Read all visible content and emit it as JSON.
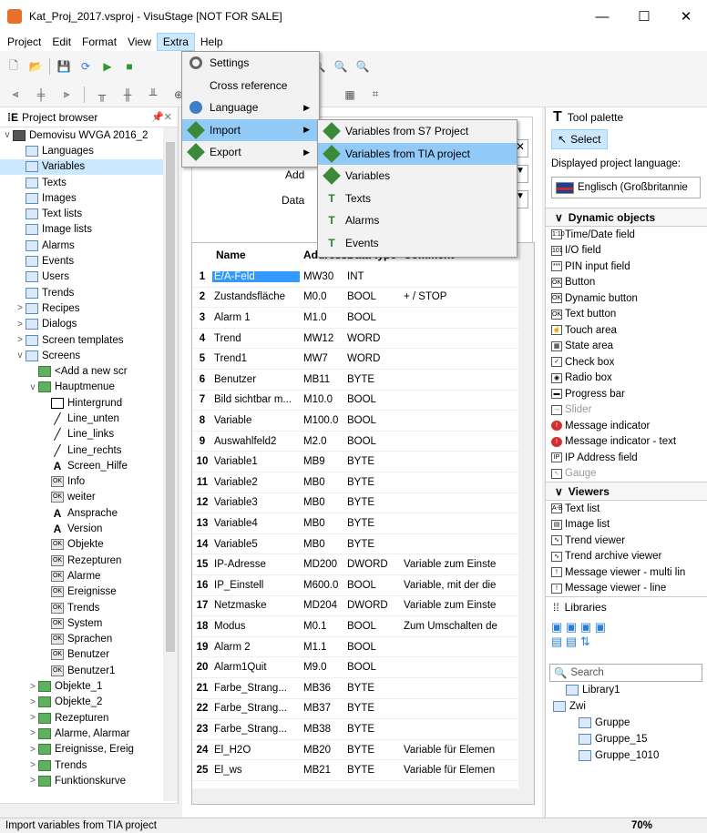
{
  "window": {
    "title": "Kat_Proj_2017.vsproj - VisuStage [NOT FOR SALE]",
    "minimize": "—",
    "maximize": "☐",
    "close": "✕"
  },
  "menubar": [
    "Project",
    "Edit",
    "Format",
    "View",
    "Extra",
    "Help"
  ],
  "project_browser": {
    "title": "Project browser",
    "pin": "📌✕",
    "items": [
      {
        "label": "Demovisu WVGA 2016_2",
        "level": 0,
        "expander": "v",
        "icon": "monitor-icon"
      },
      {
        "label": "Languages",
        "level": 1,
        "expander": "",
        "icon": "folder-icon"
      },
      {
        "label": "Variables",
        "level": 1,
        "expander": "",
        "icon": "folder-icon",
        "selected": true
      },
      {
        "label": "Texts",
        "level": 1,
        "expander": "",
        "icon": "folder-icon"
      },
      {
        "label": "Images",
        "level": 1,
        "expander": "",
        "icon": "folder-icon"
      },
      {
        "label": "Text lists",
        "level": 1,
        "expander": "",
        "icon": "folder-icon"
      },
      {
        "label": "Image lists",
        "level": 1,
        "expander": "",
        "icon": "folder-icon"
      },
      {
        "label": "Alarms",
        "level": 1,
        "expander": "",
        "icon": "folder-icon"
      },
      {
        "label": "Events",
        "level": 1,
        "expander": "",
        "icon": "folder-icon"
      },
      {
        "label": "Users",
        "level": 1,
        "expander": "",
        "icon": "folder-icon"
      },
      {
        "label": "Trends",
        "level": 1,
        "expander": "",
        "icon": "folder-icon"
      },
      {
        "label": "Recipes",
        "level": 1,
        "expander": ">",
        "icon": "folder-icon"
      },
      {
        "label": "Dialogs",
        "level": 1,
        "expander": ">",
        "icon": "folder-icon"
      },
      {
        "label": "Screen templates",
        "level": 1,
        "expander": ">",
        "icon": "folder-icon"
      },
      {
        "label": "Screens",
        "level": 1,
        "expander": "v",
        "icon": "folder-icon"
      },
      {
        "label": "<Add a new scr",
        "level": 2,
        "expander": "",
        "icon": "plus-icon"
      },
      {
        "label": "Hauptmenue",
        "level": 2,
        "expander": "v",
        "icon": "screen-icon"
      },
      {
        "label": "Hintergrund",
        "level": 3,
        "expander": "",
        "icon": "rect-icon"
      },
      {
        "label": "Line_unten",
        "level": 3,
        "expander": "",
        "icon": "line-icon"
      },
      {
        "label": "Line_links",
        "level": 3,
        "expander": "",
        "icon": "line-icon"
      },
      {
        "label": "Line_rechts",
        "level": 3,
        "expander": "",
        "icon": "line-icon"
      },
      {
        "label": "Screen_Hilfe",
        "level": 3,
        "expander": "",
        "icon": "text-icon"
      },
      {
        "label": "Info",
        "level": 3,
        "expander": "",
        "icon": "button-icon"
      },
      {
        "label": "weiter",
        "level": 3,
        "expander": "",
        "icon": "button-icon"
      },
      {
        "label": "Ansprache",
        "level": 3,
        "expander": "",
        "icon": "text-icon"
      },
      {
        "label": "Version",
        "level": 3,
        "expander": "",
        "icon": "text-icon"
      },
      {
        "label": "Objekte",
        "level": 3,
        "expander": "",
        "icon": "button-icon"
      },
      {
        "label": "Rezepturen",
        "level": 3,
        "expander": "",
        "icon": "button-icon"
      },
      {
        "label": "Alarme",
        "level": 3,
        "expander": "",
        "icon": "button-icon"
      },
      {
        "label": "Ereignisse",
        "level": 3,
        "expander": "",
        "icon": "button-icon"
      },
      {
        "label": "Trends",
        "level": 3,
        "expander": "",
        "icon": "button-icon"
      },
      {
        "label": "System",
        "level": 3,
        "expander": "",
        "icon": "button-icon"
      },
      {
        "label": "Sprachen",
        "level": 3,
        "expander": "",
        "icon": "button-icon"
      },
      {
        "label": "Benutzer",
        "level": 3,
        "expander": "",
        "icon": "button-icon"
      },
      {
        "label": "Benutzer1",
        "level": 3,
        "expander": "",
        "icon": "button-icon"
      },
      {
        "label": "Objekte_1",
        "level": 2,
        "expander": ">",
        "icon": "screen-icon"
      },
      {
        "label": "Objekte_2",
        "level": 2,
        "expander": ">",
        "icon": "screen-icon"
      },
      {
        "label": "Rezepturen",
        "level": 2,
        "expander": ">",
        "icon": "screen-icon"
      },
      {
        "label": "Alarme, Alarmar",
        "level": 2,
        "expander": ">",
        "icon": "screen-icon"
      },
      {
        "label": "Ereignisse, Ereig",
        "level": 2,
        "expander": ">",
        "icon": "screen-icon"
      },
      {
        "label": "Trends",
        "level": 2,
        "expander": ">",
        "icon": "screen-icon"
      },
      {
        "label": "Funktionskurve",
        "level": 2,
        "expander": ">",
        "icon": "screen-icon"
      }
    ]
  },
  "variables_editor": {
    "field_labels": {
      "address": "Add",
      "datatype": "Data"
    },
    "columns": [
      "Name",
      "Address",
      "Data type",
      "Comment"
    ],
    "rows": [
      {
        "n": "1",
        "name": "E/A-Feld",
        "addr": "MW30",
        "type": "INT",
        "comment": ""
      },
      {
        "n": "2",
        "name": "Zustandsfläche",
        "addr": "M0.0",
        "type": "BOOL",
        "comment": "+ / STOP"
      },
      {
        "n": "3",
        "name": "Alarm 1",
        "addr": "M1.0",
        "type": "BOOL",
        "comment": ""
      },
      {
        "n": "4",
        "name": "Trend",
        "addr": "MW12",
        "type": "WORD",
        "comment": ""
      },
      {
        "n": "5",
        "name": "Trend1",
        "addr": "MW7",
        "type": "WORD",
        "comment": ""
      },
      {
        "n": "6",
        "name": "Benutzer",
        "addr": "MB11",
        "type": "BYTE",
        "comment": ""
      },
      {
        "n": "7",
        "name": "Bild sichtbar m...",
        "addr": "M10.0",
        "type": "BOOL",
        "comment": ""
      },
      {
        "n": "8",
        "name": "Variable",
        "addr": "M100.0",
        "type": "BOOL",
        "comment": ""
      },
      {
        "n": "9",
        "name": "Auswahlfeld2",
        "addr": "M2.0",
        "type": "BOOL",
        "comment": ""
      },
      {
        "n": "10",
        "name": "Variable1",
        "addr": "MB9",
        "type": "BYTE",
        "comment": ""
      },
      {
        "n": "11",
        "name": "Variable2",
        "addr": "MB0",
        "type": "BYTE",
        "comment": ""
      },
      {
        "n": "12",
        "name": "Variable3",
        "addr": "MB0",
        "type": "BYTE",
        "comment": ""
      },
      {
        "n": "13",
        "name": "Variable4",
        "addr": "MB0",
        "type": "BYTE",
        "comment": ""
      },
      {
        "n": "14",
        "name": "Variable5",
        "addr": "MB0",
        "type": "BYTE",
        "comment": ""
      },
      {
        "n": "15",
        "name": "IP-Adresse",
        "addr": "MD200",
        "type": "DWORD",
        "comment": "Variable zum Einste"
      },
      {
        "n": "16",
        "name": "IP_Einstell",
        "addr": "M600.0",
        "type": "BOOL",
        "comment": "Variable, mit der die"
      },
      {
        "n": "17",
        "name": "Netzmaske",
        "addr": "MD204",
        "type": "DWORD",
        "comment": "Variable zum Einste"
      },
      {
        "n": "18",
        "name": "Modus",
        "addr": "M0.1",
        "type": "BOOL",
        "comment": "Zum Umschalten de"
      },
      {
        "n": "19",
        "name": "Alarm 2",
        "addr": "M1.1",
        "type": "BOOL",
        "comment": ""
      },
      {
        "n": "20",
        "name": "Alarm1Quit",
        "addr": "M9.0",
        "type": "BOOL",
        "comment": ""
      },
      {
        "n": "21",
        "name": "Farbe_Strang...",
        "addr": "MB36",
        "type": "BYTE",
        "comment": ""
      },
      {
        "n": "22",
        "name": "Farbe_Strang...",
        "addr": "MB37",
        "type": "BYTE",
        "comment": ""
      },
      {
        "n": "23",
        "name": "Farbe_Strang...",
        "addr": "MB38",
        "type": "BYTE",
        "comment": ""
      },
      {
        "n": "24",
        "name": "El_H2O",
        "addr": "MB20",
        "type": "BYTE",
        "comment": "Variable für Elemen"
      },
      {
        "n": "25",
        "name": "El_ws",
        "addr": "MB21",
        "type": "BYTE",
        "comment": "Variable für Elemen"
      }
    ]
  },
  "extra_menu": [
    {
      "label": "Settings",
      "icon": "gear-icon",
      "arrow": ""
    },
    {
      "label": "Cross reference",
      "icon": "",
      "arrow": ""
    },
    {
      "label": "Language",
      "icon": "globe-icon",
      "arrow": "▶"
    },
    {
      "label": "Import",
      "icon": "import-icon",
      "arrow": "▶",
      "highlight": true
    },
    {
      "label": "Export",
      "icon": "export-icon",
      "arrow": "▶"
    }
  ],
  "import_submenu": [
    {
      "label": "Variables from S7 Project",
      "icon": "import-icon"
    },
    {
      "label": "Variables from TIA project",
      "icon": "import-icon",
      "highlight": true
    },
    {
      "label": "Variables",
      "icon": "import-icon"
    },
    {
      "label": "Texts",
      "icon": "text-import-icon"
    },
    {
      "label": "Alarms",
      "icon": "text-import-icon"
    },
    {
      "label": "Events",
      "icon": "text-import-icon"
    }
  ],
  "tool_palette": {
    "title": "Tool palette",
    "select_label": "Select",
    "lang_label": "Displayed project language:",
    "lang_value": "Englisch (Großbritannie",
    "dynamic_title": "Dynamic objects",
    "dynamic_items": [
      {
        "label": "Time/Date field",
        "badge": "1:10"
      },
      {
        "label": "I/O field",
        "badge": "101"
      },
      {
        "label": "PIN input field",
        "badge": "***"
      },
      {
        "label": "Button",
        "badge": "OK"
      },
      {
        "label": "Dynamic button",
        "badge": "OK"
      },
      {
        "label": "Text button",
        "badge": "OK"
      },
      {
        "label": "Touch area",
        "badge": "☝"
      },
      {
        "label": "State area",
        "badge": "▦"
      },
      {
        "label": "Check box",
        "badge": "✓"
      },
      {
        "label": "Radio box",
        "badge": "◉"
      },
      {
        "label": "Progress bar",
        "badge": "▬"
      },
      {
        "label": "Slider",
        "badge": "⊸",
        "dim": true
      },
      {
        "label": "Message indicator",
        "badge": "!",
        "red": true
      },
      {
        "label": "Message indicator - text",
        "badge": "!",
        "red": true
      },
      {
        "label": "IP Address field",
        "badge": "IP"
      },
      {
        "label": "Gauge",
        "badge": "↖",
        "dim": true
      }
    ],
    "viewers_title": "Viewers",
    "viewer_items": [
      {
        "label": "Text list",
        "badge": "A-B"
      },
      {
        "label": "Image list",
        "badge": "▤"
      },
      {
        "label": "Trend viewer",
        "badge": "∿"
      },
      {
        "label": "Trend archive viewer",
        "badge": "∿"
      },
      {
        "label": "Message viewer - multi lin",
        "badge": "!"
      },
      {
        "label": "Message viewer - line",
        "badge": "!"
      }
    ],
    "libraries_title": "Libraries",
    "search_placeholder": "Search",
    "library_items": [
      {
        "label": "Library1",
        "level": 1
      },
      {
        "label": "Zwi",
        "level": 0
      },
      {
        "label": "Gruppe",
        "level": 2
      },
      {
        "label": "Gruppe_15",
        "level": 2
      },
      {
        "label": "Gruppe_1010",
        "level": 2
      }
    ]
  },
  "status_bar": {
    "text": "Import variables from TIA project",
    "zoom": "70%"
  }
}
